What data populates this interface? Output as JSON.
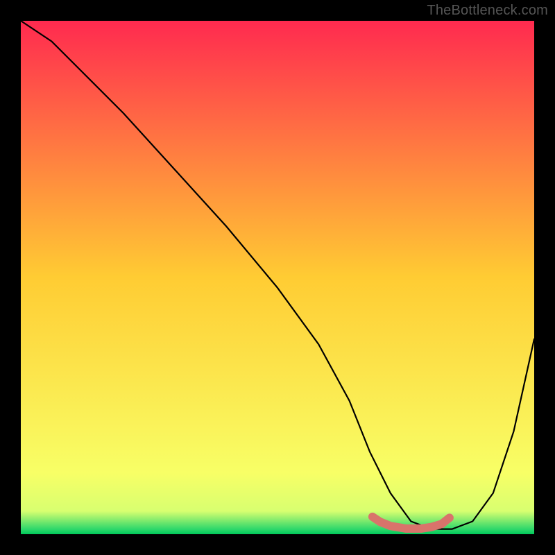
{
  "watermark": "TheBottleneck.com",
  "chart_data": {
    "type": "line",
    "title": "",
    "xlabel": "",
    "ylabel": "",
    "xlim": [
      0,
      100
    ],
    "ylim": [
      0,
      100
    ],
    "grid": false,
    "legend": false,
    "background_gradient": {
      "stops": [
        {
          "offset": 0.0,
          "color": "#ff2a4f"
        },
        {
          "offset": 0.5,
          "color": "#ffcc33"
        },
        {
          "offset": 0.88,
          "color": "#f8ff66"
        },
        {
          "offset": 0.955,
          "color": "#d8ff70"
        },
        {
          "offset": 0.99,
          "color": "#2fd86b"
        },
        {
          "offset": 1.0,
          "color": "#00c85a"
        }
      ]
    },
    "series": [
      {
        "name": "bottleneck-curve",
        "x": [
          0,
          6,
          12,
          20,
          30,
          40,
          50,
          58,
          64,
          68,
          72,
          76,
          80,
          84,
          88,
          92,
          96,
          100
        ],
        "values": [
          100,
          96,
          90,
          82,
          71,
          60,
          48,
          37,
          26,
          16,
          8,
          2.5,
          1,
          1,
          2.5,
          8,
          20,
          38
        ]
      }
    ],
    "highlight": {
      "name": "optimal-range",
      "x": [
        68.5,
        70,
        72,
        75,
        78,
        80,
        82,
        83.5
      ],
      "values": [
        3.4,
        2.4,
        1.6,
        1.1,
        1.1,
        1.4,
        2.0,
        3.2
      ],
      "color": "#d9736b",
      "width": 12
    }
  }
}
